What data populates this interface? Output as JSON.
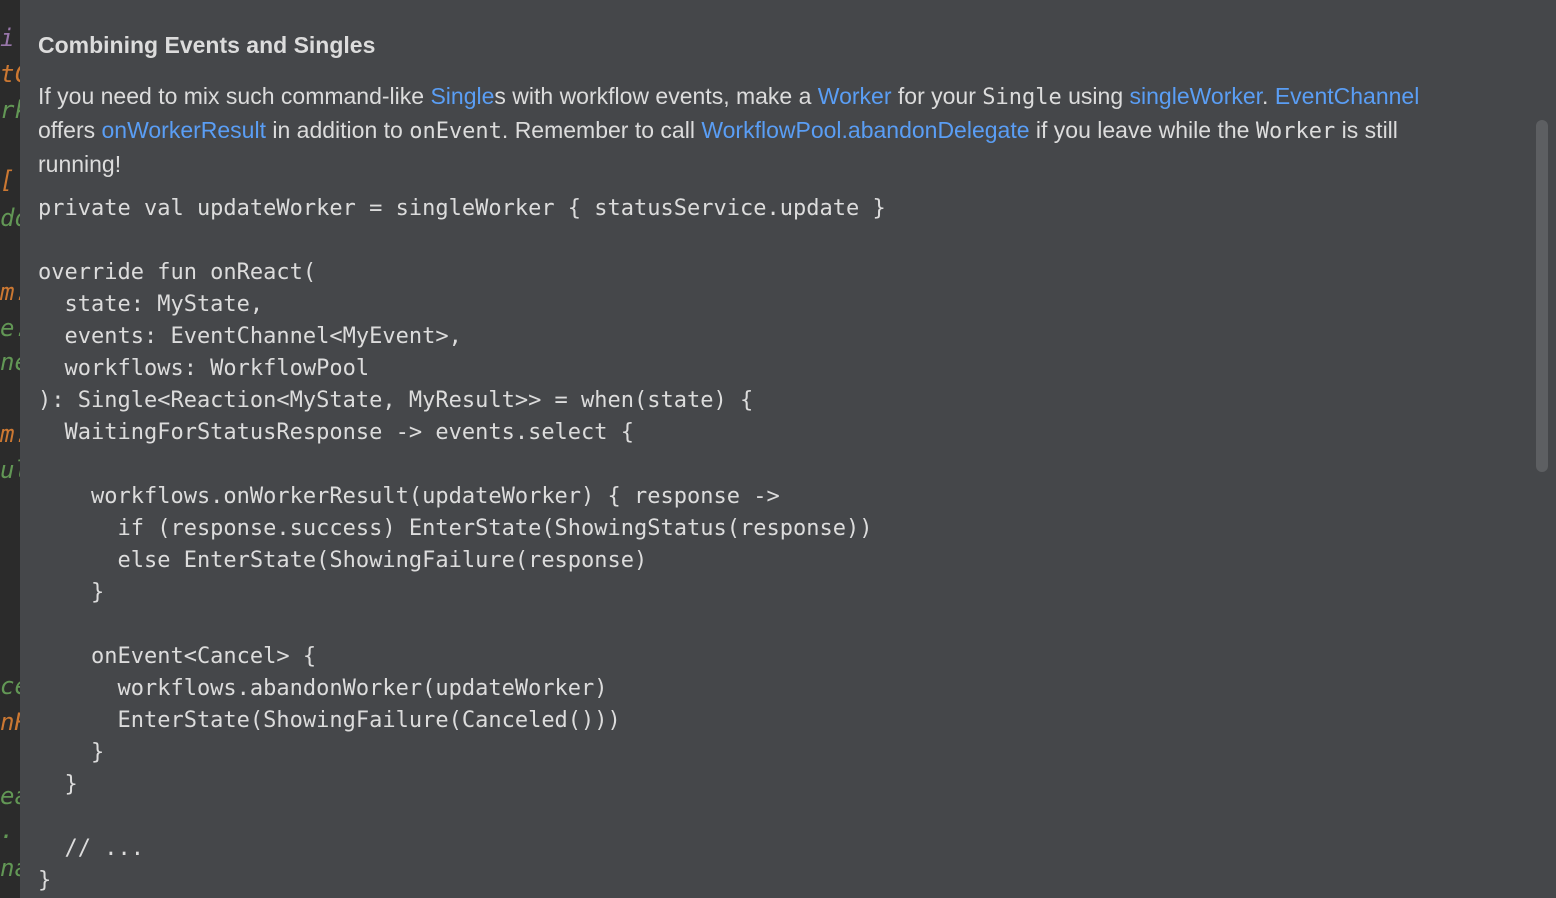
{
  "gutter_fragments": [
    {
      "text": "i",
      "color": "#9876aa"
    },
    {
      "text": "tC",
      "color": "#cc7832"
    },
    {
      "text": "rk",
      "color": "#629755"
    },
    {
      "text": "[",
      "color": "#cc7832"
    },
    {
      "text": "do",
      "color": "#629755"
    },
    {
      "text": "m.",
      "color": "#cc7832"
    },
    {
      "text": "e.",
      "color": "#629755"
    },
    {
      "text": "ne",
      "color": "#629755"
    },
    {
      "text": "m.",
      "color": "#cc7832"
    },
    {
      "text": "ul",
      "color": "#629755"
    },
    {
      "text": "ce",
      "color": "#629755"
    },
    {
      "text": "nR",
      "color": "#cc7832"
    },
    {
      "text": "ea",
      "color": "#629755"
    },
    {
      "text": ".",
      "color": "#629755"
    },
    {
      "text": "na",
      "color": "#629755"
    }
  ],
  "doc": {
    "title": "Combining Events and Singles",
    "para": {
      "t1": "If you need to mix such command-like ",
      "l1": "Single",
      "t2": "s with workflow events, make a ",
      "l2": "Worker",
      "t3": " for your ",
      "c1": "Single",
      "t4": " using ",
      "l3": "singleWorker",
      "t5": ". ",
      "l4": "EventChannel",
      "t6": " offers ",
      "l5": "onWorkerResult",
      "t7": " in addition to ",
      "c2": "onEvent",
      "t8": ". Remember to call ",
      "l6": "WorkflowPool.abandonDelegate",
      "t9": " if you leave while the ",
      "c3": "Worker",
      "t10": " is still running!"
    },
    "code": "private val updateWorker = singleWorker { statusService.update }\n\noverride fun onReact(\n  state: MyState,\n  events: EventChannel<MyEvent>,\n  workflows: WorkflowPool\n): Single<Reaction<MyState, MyResult>> = when(state) {\n  WaitingForStatusResponse -> events.select {\n\n    workflows.onWorkerResult(updateWorker) { response ->\n      if (response.success) EnterState(ShowingStatus(response))\n      else EnterState(ShowingFailure(response)\n    }\n\n    onEvent<Cancel> {\n      workflows.abandonWorker(updateWorker)\n      EnterState(ShowingFailure(Canceled()))\n    }\n  }\n\n  // ...\n}"
  },
  "colors": {
    "popup_bg": "#45474a",
    "text": "#dcdcdc",
    "link": "#5a9ef5",
    "editor_bg": "#2b2b2b"
  }
}
